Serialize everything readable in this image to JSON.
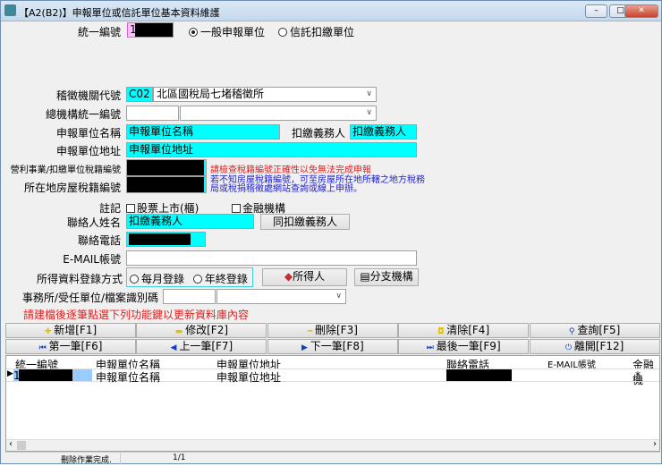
{
  "window": {
    "title": "【A2(B2)】申報單位或信託單位基本資料維護"
  },
  "form": {
    "ban_label": "統一編號",
    "ban_value": "1",
    "radio_general": "一般申報單位",
    "radio_trust": "信託扣繳單位",
    "agency_label": "稽徵機關代號",
    "agency_code": "C02",
    "agency_name": "北區國稅局七堵稽徵所",
    "hq_label": "總機構統一編號",
    "unit_name_label": "申報單位名稱",
    "unit_name": "申報單位名稱",
    "withholder_label": "扣繳義務人",
    "withholder": "扣繳義務人",
    "unit_addr_label": "申報單位地址",
    "unit_addr": "申報單位地址",
    "tax_reg_label": "營利事業/扣繳單位稅籍編號",
    "house_tax_label": "所在地房屋稅籍編號",
    "tax_reg_warning": "請檢查稅籍編號正確性以免無法完成申報",
    "house_tax_hint": "若不知房屋稅籍編號，可至房屋所在地所轄之地方稅務局或稅捐稽徵處網站查詢或線上申辦。",
    "note_label": "註記",
    "chk_listed": "股票上市(櫃)",
    "chk_financial": "金融機構",
    "contact_label": "聯絡人姓名",
    "contact": "扣繳義務人",
    "same_as_btn": "同扣繳義務人",
    "phone_label": "聯絡電話",
    "email_label": "E-MAIL帳號",
    "entry_label": "所得資料登錄方式",
    "entry_monthly": "每月登錄",
    "entry_yearly": "年終登錄",
    "income_btn": "所得人",
    "branch_btn": "分支機構",
    "office_label": "事務所/受任單位/檔案識別碼",
    "instruction": "請建檔後逐筆點選下列功能鍵以更新資料庫內容"
  },
  "toolbar": [
    {
      "label": "新增[F1]",
      "icon": "plus-icon",
      "color": "#e0c000"
    },
    {
      "label": "修改[F2]",
      "icon": "edit-icon",
      "color": "#e0c000"
    },
    {
      "label": "刪除[F3]",
      "icon": "minus-icon",
      "color": "#e0c000"
    },
    {
      "label": "清除[F4]",
      "icon": "clear-icon",
      "color": "#e0c000"
    },
    {
      "label": "查詢[F5]",
      "icon": "search-icon",
      "color": "#1040c0"
    },
    {
      "label": "第一筆[F6]",
      "icon": "first-icon",
      "color": "#1040c0"
    },
    {
      "label": "上一筆[F7]",
      "icon": "prev-icon",
      "color": "#1040c0"
    },
    {
      "label": "下一筆[F8]",
      "icon": "next-icon",
      "color": "#1040c0"
    },
    {
      "label": "最後一筆[F9]",
      "icon": "last-icon",
      "color": "#1040c0"
    },
    {
      "label": "離開[F12]",
      "icon": "power-icon",
      "color": "#1040c0"
    }
  ],
  "grid": {
    "headers": [
      "統一編號",
      "申報單位名稱",
      "申報單位地址",
      "聯絡電話",
      "E-MAIL帳號",
      "金融機"
    ],
    "row": {
      "ban": "1",
      "name": "申報單位名稱",
      "addr": "申報單位地址",
      "fin": "*"
    }
  },
  "status": {
    "message": "刪除作業完成.",
    "record": "1/1"
  }
}
